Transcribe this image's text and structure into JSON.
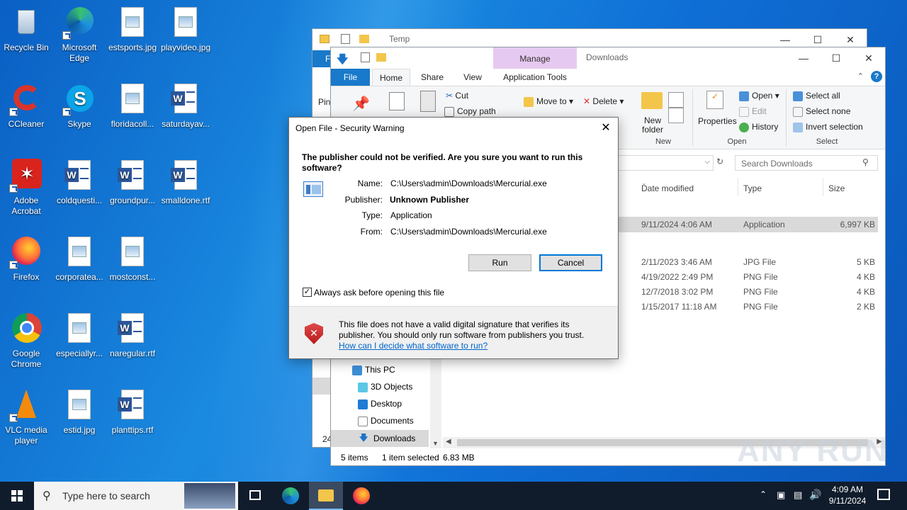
{
  "desktop": {
    "icons": [
      {
        "label": "Recycle Bin"
      },
      {
        "label": "Microsoft Edge"
      },
      {
        "label": "estsports.jpg"
      },
      {
        "label": "playvideo.jpg"
      },
      {
        "label": "CCleaner"
      },
      {
        "label": "Skype"
      },
      {
        "label": "floridacoll..."
      },
      {
        "label": "saturdayav..."
      },
      {
        "label": "Adobe Acrobat"
      },
      {
        "label": "coldquesti..."
      },
      {
        "label": "groundpur..."
      },
      {
        "label": "smalldone.rtf"
      },
      {
        "label": "Firefox"
      },
      {
        "label": "corporatea..."
      },
      {
        "label": "mostconst..."
      },
      {
        "label": "Google Chrome"
      },
      {
        "label": "especiallyr..."
      },
      {
        "label": "naregular.rtf"
      },
      {
        "label": "VLC media player"
      },
      {
        "label": "estid.jpg"
      },
      {
        "label": "planttips.rtf"
      }
    ]
  },
  "temp_window": {
    "title": "Temp",
    "file_tab": "F",
    "pin_label": "Pin",
    "status_count": "24"
  },
  "downloads_window": {
    "title": "Downloads",
    "context_tab_group": "Manage",
    "tabs": {
      "file": "File",
      "home": "Home",
      "share": "Share",
      "view": "View",
      "app_tools": "Application Tools"
    },
    "ribbon": {
      "cut": "Cut",
      "copy_path": "Copy path",
      "move_to": "Move to",
      "delete": "Delete",
      "new_folder": "New folder",
      "properties": "Properties",
      "open": "Open",
      "edit": "Edit",
      "history": "History",
      "select_all": "Select all",
      "select_none": "Select none",
      "invert_selection": "Invert selection",
      "group_new": "New",
      "group_open": "Open",
      "group_select": "Select"
    },
    "search_placeholder": "Search Downloads",
    "columns": {
      "date": "Date modified",
      "type": "Type",
      "size": "Size"
    },
    "rows": [
      {
        "date": "9/11/2024 4:06 AM",
        "type": "Application",
        "size": "6,997 KB"
      },
      {
        "date": "2/11/2023 3:46 AM",
        "type": "JPG File",
        "size": "5 KB"
      },
      {
        "date": "4/19/2022 2:49 PM",
        "type": "PNG File",
        "size": "4 KB"
      },
      {
        "date": "12/7/2018 3:02 PM",
        "type": "PNG File",
        "size": "4 KB"
      },
      {
        "date": "1/15/2017 11:18 AM",
        "type": "PNG File",
        "size": "2 KB"
      }
    ],
    "nav": [
      {
        "label": "This PC"
      },
      {
        "label": "3D Objects"
      },
      {
        "label": "Desktop"
      },
      {
        "label": "Documents"
      },
      {
        "label": "Downloads"
      }
    ],
    "status": {
      "items": "5 items",
      "selected": "1 item selected",
      "size": "6.83 MB"
    }
  },
  "dialog": {
    "title": "Open File - Security Warning",
    "question": "The publisher could not be verified.  Are you sure you want to run this software?",
    "name_label": "Name:",
    "name_value": "C:\\Users\\admin\\Downloads\\Mercurial.exe",
    "publisher_label": "Publisher:",
    "publisher_value": "Unknown Publisher",
    "type_label": "Type:",
    "type_value": "Application",
    "from_label": "From:",
    "from_value": "C:\\Users\\admin\\Downloads\\Mercurial.exe",
    "run": "Run",
    "cancel": "Cancel",
    "always_ask": "Always ask before opening this file",
    "warning_text": "This file does not have a valid digital signature that verifies its publisher.  You should only run software from publishers you trust.",
    "help_link": "How can I decide what software to run?"
  },
  "taskbar": {
    "search_placeholder": "Type here to search",
    "time": "4:09 AM",
    "date": "9/11/2024"
  },
  "watermark": "ANY RUN"
}
